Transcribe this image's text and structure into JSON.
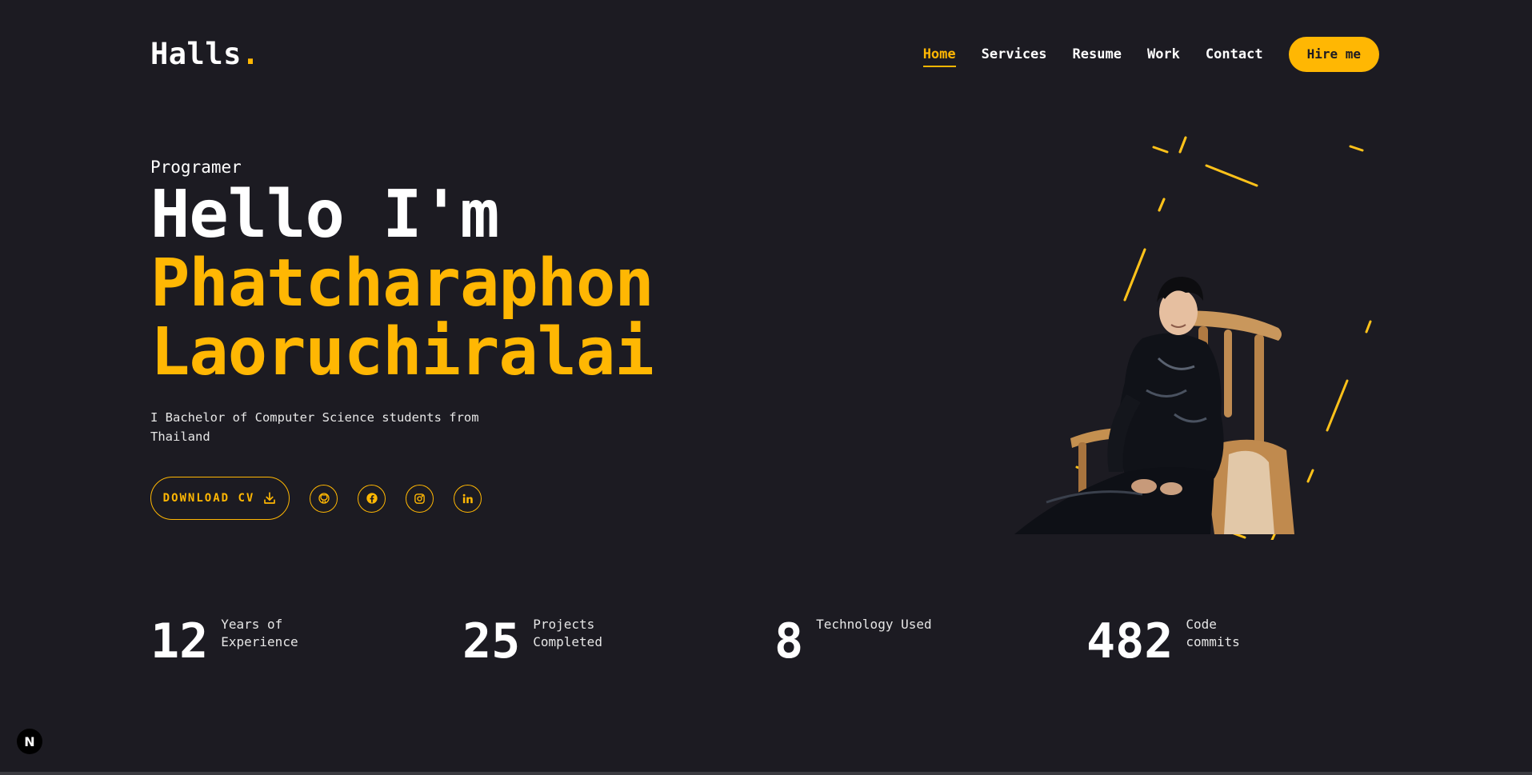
{
  "header": {
    "logo_text": "Halls",
    "logo_dot": ".",
    "nav": [
      "Home",
      "Services",
      "Resume",
      "Work",
      "Contact"
    ],
    "cta": "Hire me"
  },
  "hero": {
    "role": "Programer",
    "greeting": "Hello I'm",
    "first_name": "Phatcharaphon",
    "last_name": "Laoruchiralai",
    "description": "I Bachelor of Computer Science students from Thailand",
    "download_label": "DOWNLOAD CV",
    "socials": [
      "github-icon",
      "facebook-icon",
      "instagram-icon",
      "linkedin-icon"
    ]
  },
  "stats": [
    {
      "number": "12",
      "label_line1": "Years of",
      "label_line2": "Experience"
    },
    {
      "number": "25",
      "label_line1": "Projects",
      "label_line2": "Completed"
    },
    {
      "number": "8",
      "label_line1": "Technology Used",
      "label_line2": ""
    },
    {
      "number": "482",
      "label_line1": "Code",
      "label_line2": "commits"
    }
  ],
  "badge": "N",
  "colors": {
    "background": "#1c1b22",
    "accent": "#ffb703",
    "text": "#ffffff"
  }
}
